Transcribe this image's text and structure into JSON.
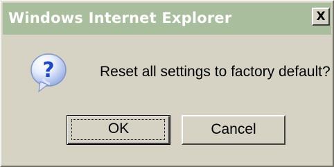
{
  "window": {
    "title": "Windows Internet Explorer",
    "close_label": "X"
  },
  "message": {
    "text": "Reset all settings to factory default?",
    "icon": "question-icon"
  },
  "buttons": {
    "ok_label": "OK",
    "cancel_label": "Cancel"
  },
  "colors": {
    "dialog_bg": "#d6d3c4",
    "titlebar": "#a9be9c",
    "title_text": "#ffffff",
    "icon_bubble": "#2e5bd7"
  }
}
